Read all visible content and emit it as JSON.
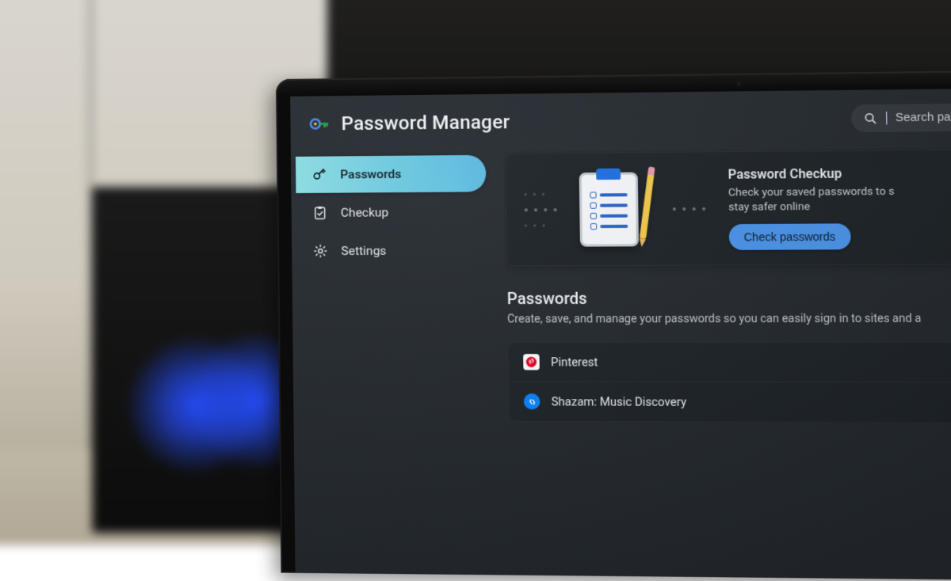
{
  "header": {
    "app_title": "Password Manager",
    "search_placeholder": "Search passwords"
  },
  "sidebar": {
    "items": [
      {
        "label": "Passwords",
        "icon": "key-icon",
        "active": true
      },
      {
        "label": "Checkup",
        "icon": "clipboard-check-icon",
        "active": false
      },
      {
        "label": "Settings",
        "icon": "gear-icon",
        "active": false
      }
    ]
  },
  "checkup": {
    "title": "Password Checkup",
    "desc_line1": "Check your saved passwords to s",
    "desc_line2": "stay safer online",
    "button": "Check passwords"
  },
  "passwords_section": {
    "heading": "Passwords",
    "subtext": "Create, save, and manage your passwords so you can easily sign in to sites and a"
  },
  "password_items": [
    {
      "label": "Pinterest",
      "icon": "pinterest-icon"
    },
    {
      "label": "Shazam: Music Discovery",
      "icon": "shazam-icon"
    }
  ],
  "colors": {
    "accent_pill": "#6cc9df",
    "primary_button": "#4b95ea",
    "screen_bg": "#262b30"
  }
}
